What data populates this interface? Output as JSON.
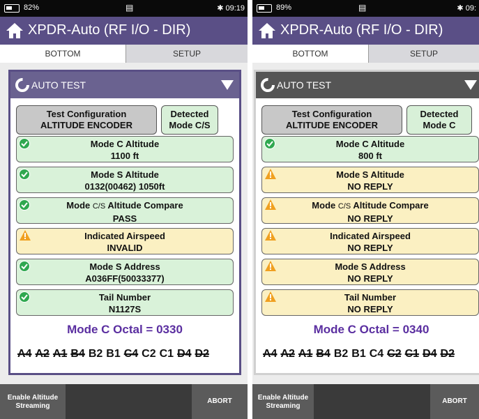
{
  "screens": [
    {
      "status": {
        "battery": "82%",
        "time": "09:19"
      },
      "title": "XPDR-Auto (RF I/O - DIR)",
      "tabs": [
        "BOTTOM",
        "SETUP"
      ],
      "header": "AUTO TEST",
      "config": {
        "label": "Test Configuration",
        "value": "ALTITUDE ENCODER"
      },
      "detected": {
        "label": "Detected",
        "value": "Mode C/S"
      },
      "results": [
        {
          "label": "Mode C Altitude",
          "value": "1100 ft",
          "status": "pass"
        },
        {
          "label": "Mode S Altitude",
          "value": "0132(00462) 1050ft",
          "status": "pass"
        },
        {
          "label_pre": "Mode ",
          "label_cs": "C/S",
          "label_post": " Altitude Compare",
          "value": "PASS",
          "status": "pass"
        },
        {
          "label": "Indicated Airspeed",
          "value": "INVALID",
          "status": "warn"
        },
        {
          "label": "Mode S Address",
          "value": "A036FF(50033377)",
          "status": "pass"
        },
        {
          "label": "Tail Number",
          "value": "N1127S",
          "status": "pass"
        }
      ],
      "octal": "Mode C Octal = 0330",
      "bits": [
        "A4",
        "A2",
        "A1",
        "B4",
        "B2",
        "B1",
        "C4",
        "C2",
        "C1",
        "D4",
        "D2"
      ],
      "bits_struck": [
        true,
        true,
        true,
        true,
        false,
        false,
        true,
        false,
        false,
        true,
        true
      ],
      "buttons": {
        "stream_line1": "Enable Altitude",
        "stream_line2": "Streaming",
        "abort": "ABORT"
      }
    },
    {
      "status": {
        "battery": "89%",
        "time": "09:"
      },
      "title": "XPDR-Auto (RF I/O - DIR)",
      "tabs": [
        "BOTTOM",
        "SETUP"
      ],
      "header": "AUTO TEST",
      "config": {
        "label": "Test Configuration",
        "value": "ALTITUDE ENCODER"
      },
      "detected": {
        "label": "Detected",
        "value": "Mode C"
      },
      "results": [
        {
          "label": "Mode C Altitude",
          "value": "800 ft",
          "status": "pass"
        },
        {
          "label": "Mode S Altitude",
          "value": "NO REPLY",
          "status": "warn"
        },
        {
          "label_pre": "Mode ",
          "label_cs": "C/S",
          "label_post": " Altitude Compare",
          "value": "NO REPLY",
          "status": "warn"
        },
        {
          "label": "Indicated Airspeed",
          "value": "NO REPLY",
          "status": "warn"
        },
        {
          "label": "Mode S Address",
          "value": "NO REPLY",
          "status": "warn"
        },
        {
          "label": "Tail Number",
          "value": "NO REPLY",
          "status": "warn"
        }
      ],
      "octal": "Mode C Octal = 0340",
      "bits": [
        "A4",
        "A2",
        "A1",
        "B4",
        "B2",
        "B1",
        "C4",
        "C2",
        "C1",
        "D4",
        "D2"
      ],
      "bits_struck": [
        true,
        true,
        true,
        true,
        false,
        false,
        false,
        true,
        true,
        true,
        true
      ],
      "buttons": {
        "stream_line1": "Enable Altitude",
        "stream_line2": "Streaming",
        "abort": "ABORT"
      }
    }
  ],
  "colors": {
    "title_bar": "#5a4f86",
    "content_border": "#5a4f86",
    "pass_bg": "#d9f2d9",
    "warn_bg": "#fbf0c2",
    "pass_icon": "#2fa84f",
    "warn_icon": "#f0a020",
    "octal_text": "#5a2ea0"
  },
  "icons": {
    "home": "home-icon",
    "spinner": "spinner-icon",
    "dropdown": "dropdown-arrow-icon",
    "pass": "check-circle-icon",
    "warn": "warning-triangle-icon",
    "bluetooth": "bluetooth-icon",
    "notification": "notification-icon",
    "battery": "battery-icon"
  }
}
